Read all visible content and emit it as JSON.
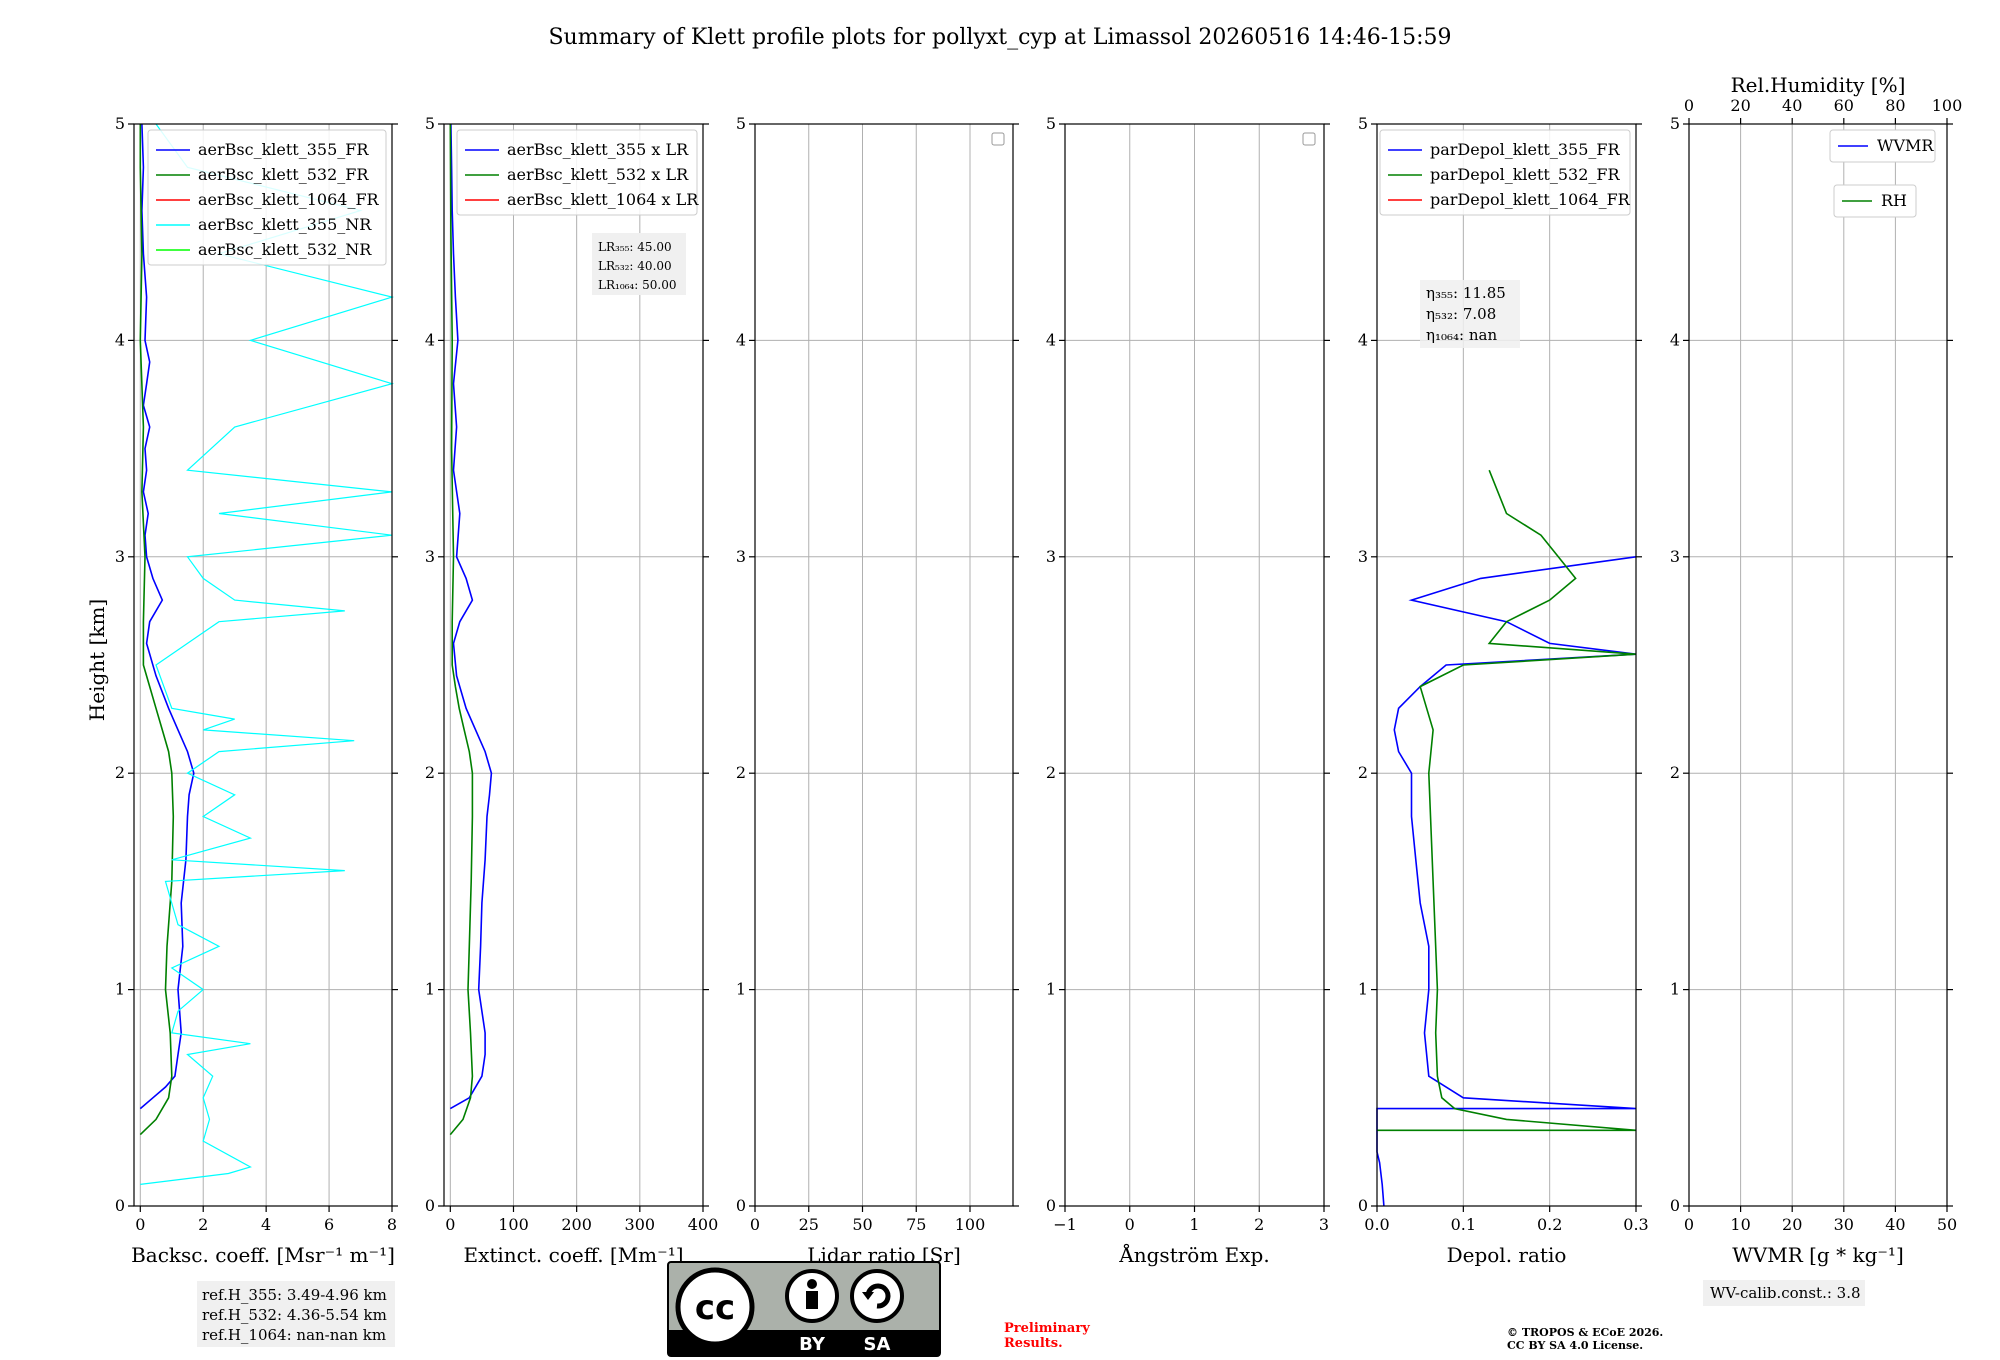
{
  "title": "Summary of Klett profile plots for pollyxt_cyp at Limassol 20260516 14:46-15:59",
  "colors": {
    "c355": "#0000ff",
    "c532": "#008000",
    "c1064": "#ff0000",
    "c355nr": "#00ffff",
    "c532nr": "#00ff00",
    "grid": "#b0b0b0",
    "prelim": "#ff0000"
  },
  "chart_data": [
    {
      "type": "line",
      "name": "Backscatter",
      "xlabel": "Backsc. coeff. [Msr⁻¹ m⁻¹]",
      "ylabel": "Height [km]",
      "xlim": [
        -0.2,
        8
      ],
      "ylim": [
        0,
        5
      ],
      "grid": true,
      "xticks": [
        "0",
        "2",
        "4",
        "6",
        "8"
      ],
      "yticks": [
        "0",
        "1",
        "2",
        "3",
        "4",
        "5"
      ],
      "legend_position": "upper right",
      "legend": [
        "aerBsc_klett_355_FR",
        "aerBsc_klett_532_FR",
        "aerBsc_klett_1064_FR",
        "aerBsc_klett_355_NR",
        "aerBsc_klett_532_NR"
      ],
      "series": [
        {
          "name": "aerBsc_klett_355_FR",
          "color": "#0000ff",
          "y": [
            0.45,
            0.5,
            0.55,
            0.6,
            0.7,
            0.8,
            1.0,
            1.2,
            1.4,
            1.6,
            1.8,
            1.9,
            2.0,
            2.1,
            2.2,
            2.3,
            2.45,
            2.6,
            2.7,
            2.8,
            2.9,
            3.0,
            3.1,
            3.2,
            3.3,
            3.4,
            3.5,
            3.6,
            3.7,
            3.8,
            3.9,
            4.0,
            4.2,
            4.4,
            4.6,
            4.8,
            5.0
          ],
          "x": [
            0.0,
            0.4,
            0.8,
            1.1,
            1.2,
            1.3,
            1.2,
            1.35,
            1.3,
            1.45,
            1.5,
            1.55,
            1.7,
            1.5,
            1.2,
            0.9,
            0.5,
            0.2,
            0.3,
            0.7,
            0.4,
            0.2,
            0.15,
            0.25,
            0.1,
            0.2,
            0.15,
            0.3,
            0.1,
            0.2,
            0.3,
            0.15,
            0.2,
            0.1,
            0.05,
            0.1,
            0.05
          ]
        },
        {
          "name": "aerBsc_klett_532_FR",
          "color": "#008000",
          "y": [
            0.33,
            0.4,
            0.5,
            0.6,
            0.8,
            1.0,
            1.2,
            1.5,
            1.8,
            2.0,
            2.1,
            2.2,
            2.3,
            2.4,
            2.5,
            2.7,
            3.0,
            3.3,
            3.6,
            4.0,
            4.4,
            4.8,
            5.0
          ],
          "x": [
            0.0,
            0.5,
            0.9,
            1.0,
            0.95,
            0.8,
            0.85,
            1.0,
            1.05,
            1.0,
            0.9,
            0.7,
            0.5,
            0.3,
            0.1,
            0.1,
            0.15,
            0.05,
            0.1,
            0.0,
            0.05,
            0.0,
            0.0
          ]
        },
        {
          "name": "aerBsc_klett_1064_FR",
          "color": "#ff0000",
          "y": [],
          "x": []
        },
        {
          "name": "aerBsc_klett_355_NR",
          "color": "#00ffff",
          "y": [
            0.1,
            0.15,
            0.18,
            0.3,
            0.4,
            0.5,
            0.6,
            0.7,
            0.75,
            0.8,
            0.9,
            1.0,
            1.1,
            1.2,
            1.3,
            1.5,
            1.55,
            1.6,
            1.7,
            1.8,
            1.9,
            2.0,
            2.1,
            2.15,
            2.2,
            2.25,
            2.3,
            2.5,
            2.7,
            2.75,
            2.8,
            2.9,
            3.0,
            3.1,
            3.2,
            3.3,
            3.4,
            3.6,
            3.8,
            4.0,
            4.2,
            4.4,
            4.6,
            4.8,
            5.0
          ],
          "x": [
            0.0,
            2.8,
            3.5,
            2.0,
            2.2,
            2.0,
            2.3,
            1.5,
            3.5,
            1.0,
            1.2,
            2.0,
            1.0,
            2.5,
            1.2,
            0.8,
            6.5,
            1.0,
            3.5,
            2.0,
            3.0,
            1.5,
            2.5,
            6.8,
            2.0,
            3.0,
            1.0,
            0.5,
            2.5,
            6.5,
            3.0,
            2.0,
            1.5,
            8.0,
            2.5,
            8.0,
            1.5,
            3.0,
            8.0,
            3.5,
            8.0,
            2.5,
            7.0,
            1.5,
            0.5
          ]
        },
        {
          "name": "aerBsc_klett_532_NR",
          "color": "#00ff00",
          "y": [],
          "x": []
        }
      ],
      "annotation": [
        "ref.H_355: 3.49-4.96 km",
        "ref.H_532: 4.36-5.54 km",
        "ref.H_1064: nan-nan km"
      ]
    },
    {
      "type": "line",
      "name": "Extinction",
      "xlabel": "Extinct. coeff. [Mm⁻¹]",
      "xlim": [
        -10,
        400
      ],
      "ylim": [
        0,
        5
      ],
      "grid": true,
      "xticks": [
        "0",
        "100",
        "200",
        "300",
        "400"
      ],
      "yticks": [
        "0",
        "1",
        "2",
        "3",
        "4",
        "5"
      ],
      "legend_position": "upper right",
      "legend": [
        "aerBsc_klett_355 x LR",
        "aerBsc_klett_532 x LR",
        "aerBsc_klett_1064 x LR"
      ],
      "series": [
        {
          "name": "aerBsc_klett_355 x LR",
          "color": "#0000ff",
          "y": [
            0.45,
            0.5,
            0.6,
            0.7,
            0.8,
            0.9,
            1.0,
            1.2,
            1.4,
            1.6,
            1.8,
            1.9,
            2.0,
            2.1,
            2.2,
            2.3,
            2.45,
            2.6,
            2.7,
            2.8,
            2.9,
            3.0,
            3.2,
            3.4,
            3.6,
            3.8,
            4.0,
            4.2,
            4.4,
            4.6,
            4.8,
            5.0
          ],
          "x": [
            0,
            30,
            50,
            55,
            55,
            50,
            45,
            48,
            50,
            55,
            58,
            62,
            65,
            55,
            40,
            25,
            10,
            5,
            15,
            35,
            25,
            10,
            15,
            5,
            10,
            5,
            12,
            8,
            5,
            3,
            2,
            1
          ]
        },
        {
          "name": "aerBsc_klett_532 x LR",
          "color": "#008000",
          "y": [
            0.33,
            0.4,
            0.5,
            0.6,
            0.8,
            1.0,
            1.2,
            1.5,
            1.8,
            2.0,
            2.1,
            2.2,
            2.3,
            2.4,
            2.5,
            2.7,
            3.0,
            3.5,
            4.0,
            4.5,
            5.0
          ],
          "x": [
            0,
            20,
            32,
            35,
            32,
            28,
            30,
            33,
            35,
            35,
            30,
            22,
            14,
            8,
            3,
            3,
            5,
            2,
            3,
            1,
            0
          ]
        },
        {
          "name": "aerBsc_klett_1064 x LR",
          "color": "#ff0000",
          "y": [],
          "x": []
        }
      ],
      "annotation": [
        "LR₃₅₅: 45.00",
        "LR₅₃₂: 40.00",
        "LR₁₀₆₄: 50.00"
      ]
    },
    {
      "type": "line",
      "name": "LidarRatio",
      "xlabel": "Lidar ratio [Sr]",
      "xlim": [
        0,
        120
      ],
      "ylim": [
        0,
        5
      ],
      "grid": true,
      "xticks": [
        "0",
        "25",
        "50",
        "75",
        "100"
      ],
      "yticks": [
        "0",
        "1",
        "2",
        "3",
        "4",
        "5"
      ],
      "series": []
    },
    {
      "type": "line",
      "name": "Angstrom",
      "xlabel": "Ångström Exp.",
      "xlim": [
        -1,
        3
      ],
      "ylim": [
        0,
        5
      ],
      "grid": true,
      "xticks": [
        "−1",
        "0",
        "1",
        "2",
        "3"
      ],
      "yticks": [
        "0",
        "1",
        "2",
        "3",
        "4",
        "5"
      ],
      "series": []
    },
    {
      "type": "line",
      "name": "Depol",
      "xlabel": "Depol. ratio",
      "xlim": [
        0,
        0.3
      ],
      "ylim": [
        0,
        5
      ],
      "grid": true,
      "xticks": [
        "0.0",
        "0.1",
        "0.2",
        "0.3"
      ],
      "yticks": [
        "0",
        "1",
        "2",
        "3",
        "4",
        "5"
      ],
      "legend_position": "upper right",
      "legend": [
        "parDepol_klett_355_FR",
        "parDepol_klett_532_FR",
        "parDepol_klett_1064_FR"
      ],
      "series": [
        {
          "name": "parDepol_klett_355_FR",
          "color": "#0000ff",
          "y": [
            0.0,
            0.1,
            0.2,
            0.25,
            0.45,
            0.45,
            0.5,
            0.6,
            0.8,
            1.0,
            1.2,
            1.4,
            1.6,
            1.8,
            2.0,
            2.1,
            2.2,
            2.3,
            2.4,
            2.5,
            2.55,
            2.6,
            2.7,
            2.8,
            2.9,
            3.0
          ],
          "x": [
            0.008,
            0.006,
            0.003,
            0.0,
            0.0,
            0.3,
            0.1,
            0.06,
            0.055,
            0.06,
            0.06,
            0.05,
            0.045,
            0.04,
            0.04,
            0.025,
            0.02,
            0.025,
            0.05,
            0.08,
            0.3,
            0.2,
            0.15,
            0.04,
            0.12,
            0.3
          ]
        },
        {
          "name": "parDepol_klett_532_FR",
          "color": "#008000",
          "y": [
            0.35,
            0.35,
            0.4,
            0.45,
            0.5,
            0.6,
            0.8,
            1.0,
            1.5,
            2.0,
            2.2,
            2.4,
            2.5,
            2.55,
            2.6,
            2.7,
            2.8,
            2.9,
            3.0,
            3.1,
            3.2,
            3.3,
            3.4
          ],
          "x": [
            0.0,
            0.3,
            0.15,
            0.09,
            0.075,
            0.07,
            0.068,
            0.07,
            0.065,
            0.06,
            0.065,
            0.05,
            0.1,
            0.3,
            0.13,
            0.15,
            0.2,
            0.23,
            0.21,
            0.19,
            0.15,
            0.14,
            0.13
          ]
        },
        {
          "name": "parDepol_klett_1064_FR",
          "color": "#ff0000",
          "y": [],
          "x": []
        }
      ],
      "annotation": [
        "η₃₅₅: 11.85",
        "η₅₃₂: 7.08",
        "η₁₀₆₄: nan"
      ]
    },
    {
      "type": "line",
      "name": "WV",
      "xlabel": "WVMR [g * kg⁻¹]",
      "x2label": "Rel.Humidity [%]",
      "xlim": [
        0,
        50
      ],
      "x2lim": [
        0,
        100
      ],
      "ylim": [
        0,
        5
      ],
      "grid": true,
      "xticks": [
        "0",
        "10",
        "20",
        "30",
        "40",
        "50"
      ],
      "x2ticks": [
        "0",
        "20",
        "40",
        "60",
        "80",
        "100"
      ],
      "yticks": [
        "0",
        "1",
        "2",
        "3",
        "4",
        "5"
      ],
      "legend": [
        "WVMR",
        "RH"
      ],
      "series": [
        {
          "name": "WVMR",
          "color": "#0000ff",
          "y": [],
          "x": []
        },
        {
          "name": "RH",
          "color": "#008000",
          "y": [],
          "x": []
        }
      ],
      "annotation": [
        "WV-calib.const.: 3.8"
      ]
    }
  ],
  "license": {
    "cc": "cc",
    "by": "BY",
    "sa": "SA"
  },
  "preliminary": [
    "Preliminary",
    "Results."
  ],
  "copyright": [
    "© TROPOS & ECoE 2026.",
    "CC BY SA 4.0 License."
  ]
}
